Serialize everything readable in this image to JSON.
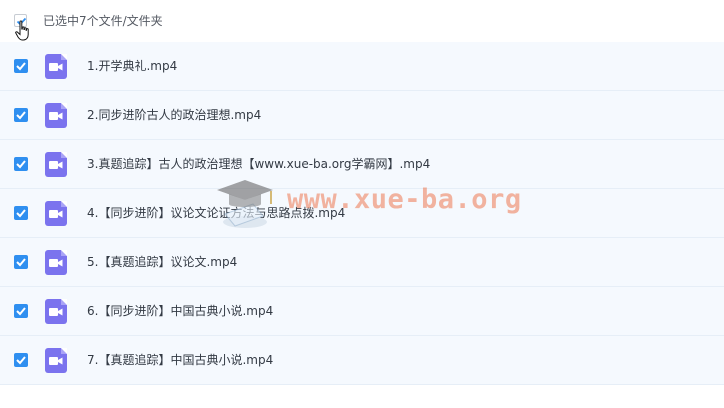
{
  "header": {
    "selection_text": "已选中7个文件/文件夹"
  },
  "files": [
    {
      "name": "1.开学典礼.mp4"
    },
    {
      "name": "2.同步进阶古人的政治理想.mp4"
    },
    {
      "name": "3.真题追踪】古人的政治理想【www.xue-ba.org学霸网】.mp4"
    },
    {
      "name": "4.【同步进阶】议论文论证方法与思路点拨.mp4"
    },
    {
      "name": "5.【真题追踪】议论文.mp4"
    },
    {
      "name": "6.【同步进阶】中国古典小说.mp4"
    },
    {
      "name": "7.【真题追踪】中国古典小说.mp4"
    }
  ],
  "watermark": {
    "text": "www.xue-ba.org"
  },
  "colors": {
    "checkbox": "#2f8ff0",
    "file_icon": "#7b73ee",
    "row_bg": "#f5f9fe",
    "watermark": "#ec7850"
  },
  "icons": {
    "file_type": "video-file-icon",
    "checkbox": "checkmark-icon",
    "cursor": "hand-pointer-icon",
    "watermark_logo": "graduation-cap-icon"
  }
}
